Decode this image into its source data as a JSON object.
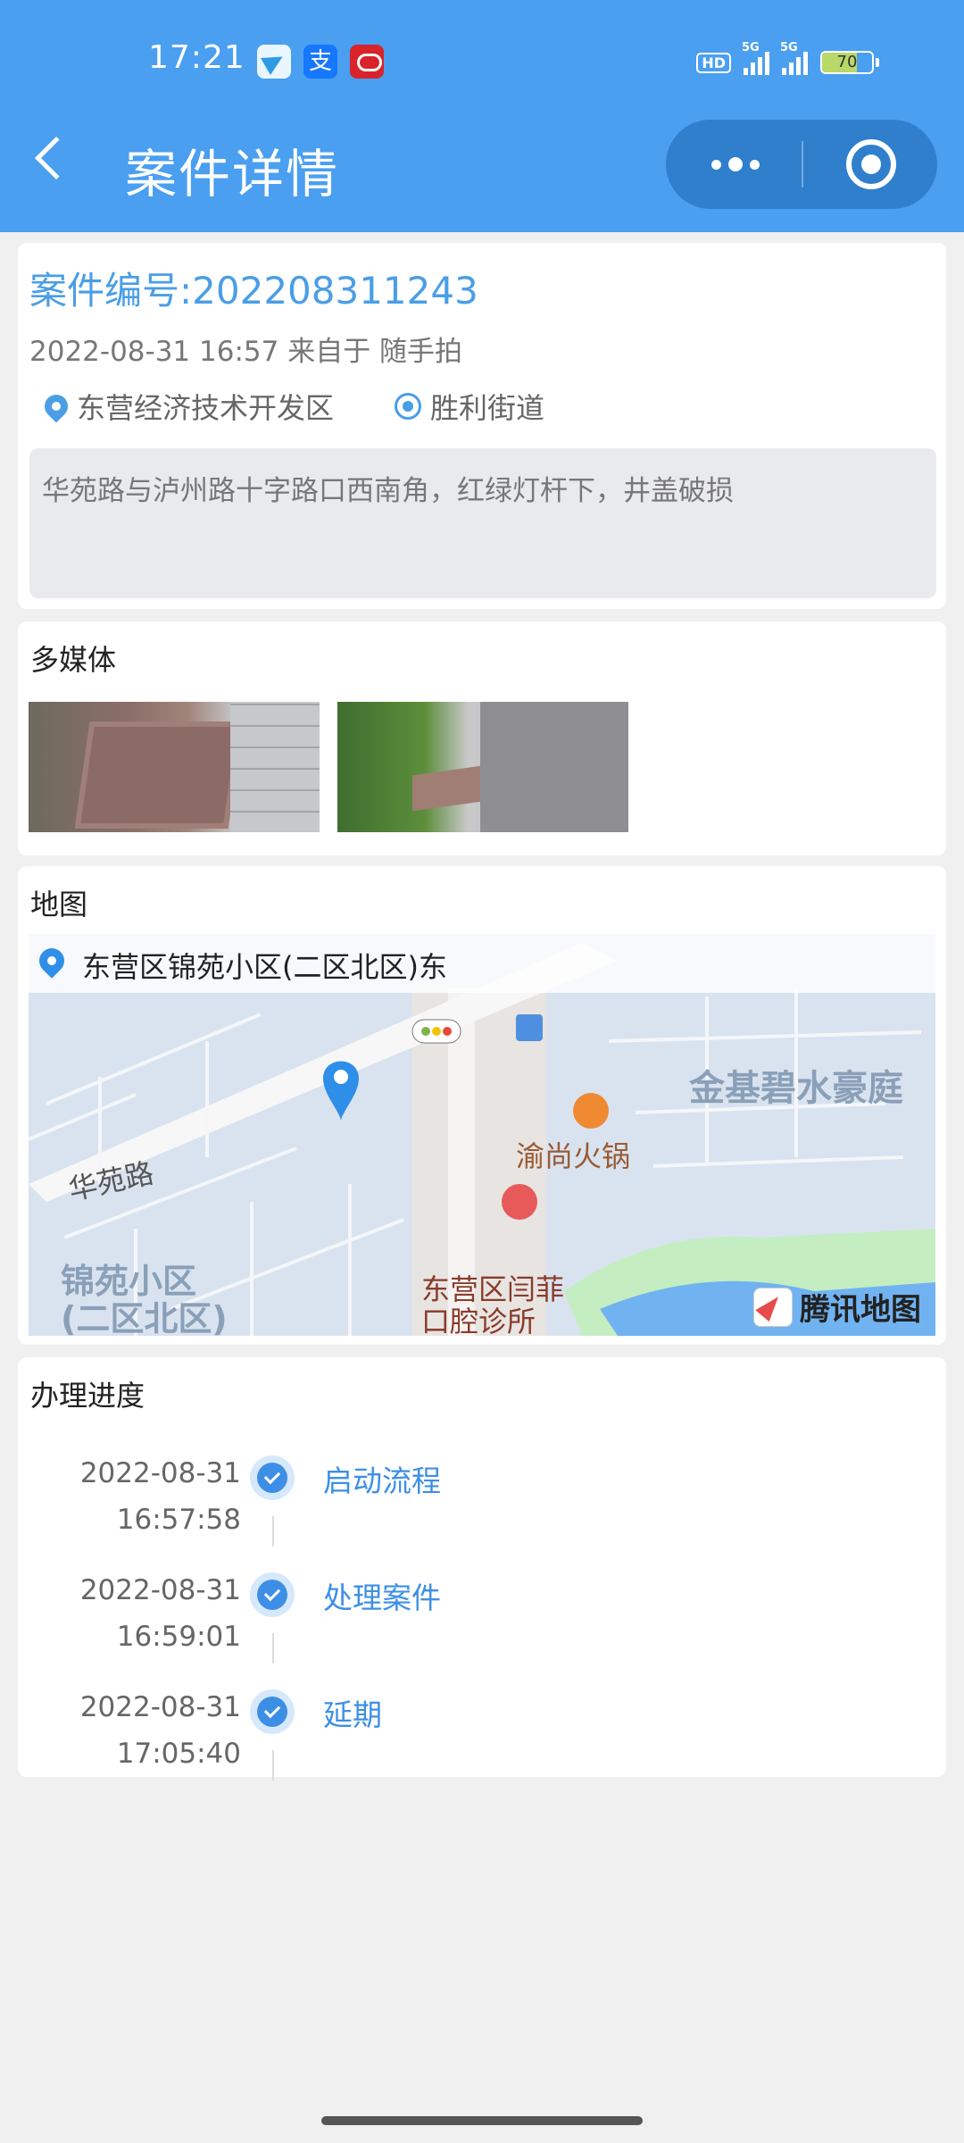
{
  "status_bar": {
    "time": "17:21",
    "app_icon_text": "支",
    "hd": "HD",
    "net1": "5G",
    "net2": "5G",
    "battery_level": 70,
    "battery_text": "70"
  },
  "nav": {
    "title": "案件详情",
    "icons": {
      "back": "chevron-left-icon",
      "more": "more-dots-icon",
      "close": "target-circle-icon"
    },
    "accent_color": "#4a9ff0"
  },
  "case": {
    "number": "案件编号:202208311243",
    "meta": "2022-08-31 16:57 来自于 随手拍",
    "district": "东营经济技术开发区",
    "street": "胜利街道",
    "description": "华苑路与泸州路十字路口西南角，红绿灯杆下，井盖破损"
  },
  "media": {
    "title": "多媒体",
    "images": [
      "manhole-photo-1",
      "manhole-photo-2"
    ]
  },
  "map": {
    "title": "地图",
    "address": "东营区锦苑小区(二区北区)东",
    "labels": {
      "road": "华苑路",
      "poi1": "渝尚火锅",
      "poi2": "金基碧水豪庭",
      "poi3": "东营区闫菲\n口腔诊所",
      "poi4": "锦苑小区\n(二区北区)"
    },
    "provider": "腾讯地图"
  },
  "progress": {
    "title": "办理进度",
    "steps": [
      {
        "date": "2022-08-31",
        "time": "16:57:58",
        "label": "启动流程"
      },
      {
        "date": "2022-08-31",
        "time": "16:59:01",
        "label": "处理案件"
      },
      {
        "date": "2022-08-31",
        "time": "17:05:40",
        "label": "延期"
      }
    ]
  }
}
